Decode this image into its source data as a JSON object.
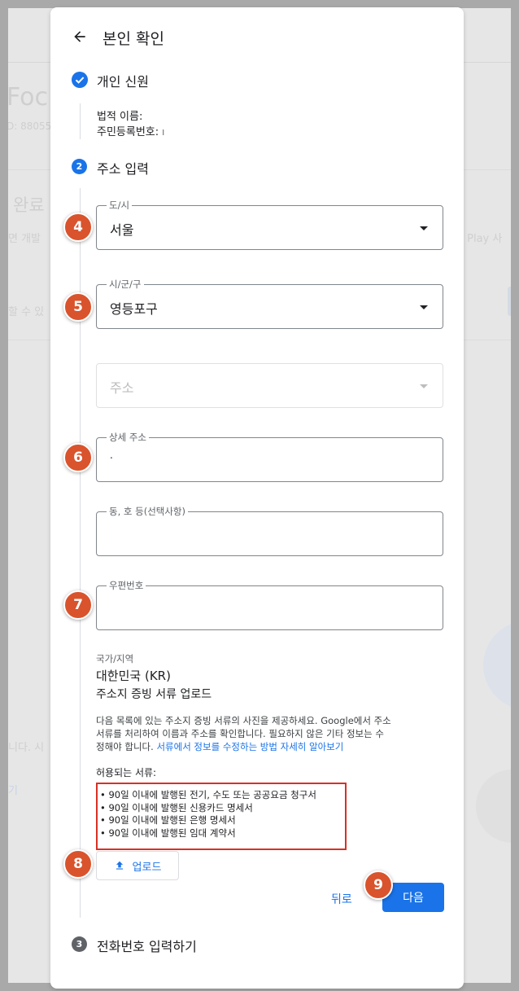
{
  "background": {
    "title_fragment": "Foc",
    "id_fragment": "D: 88055",
    "heading_fragment": "완료",
    "line1_fragment": "면 개발",
    "line1_right_fragment": "e Play 사",
    "line2_fragment": "할 수 있",
    "line3_fragment": "니다. 시",
    "line4_fragment": "기"
  },
  "dialog": {
    "title": "본인 확인",
    "step1": {
      "label": "개인 신원",
      "legal_name_label": "법적 이름:",
      "resident_number_label": "주민등록번호: ",
      "resident_number_value": "I"
    },
    "step2": {
      "number": "2",
      "label": "주소 입력",
      "fields": {
        "province": {
          "label": "도/시",
          "value": "서울"
        },
        "district": {
          "label": "시/군/구",
          "value": "영등포구"
        },
        "address": {
          "placeholder": "주소"
        },
        "detail_address": {
          "label": "상세 주소",
          "value": "."
        },
        "unit": {
          "label": "동, 호 등(선택사항)",
          "value": ""
        },
        "postal_code": {
          "label": "우편번호",
          "value": ""
        }
      },
      "country_label": "국가/지역",
      "country_value": "대한민국 (KR)",
      "upload_heading": "주소지 증빙 서류 업로드",
      "description_line1": "다음 목록에 있는 주소지 증빙 서류의 사진을 제공하세요. Google에서 주소",
      "description_line2": "서류를 처리하여 이름과 주소를 확인합니다. 필요하지 않은 기타 정보는 수",
      "description_line3": "정해야 합니다. ",
      "learn_more_link": "서류에서 정보를 수정하는 방법 자세히 알아보기",
      "accepted_docs_heading": "허용되는 서류:",
      "accepted_docs": [
        "• 90일 이내에 발행된 전기, 수도 또는 공공요금 청구서",
        "• 90일 이내에 발행된 신용카드 명세서",
        "• 90일 이내에 발행된 은행 명세서",
        "• 90일 이내에 발행된 임대 계약서"
      ],
      "upload_button": "업로드",
      "back_button": "뒤로",
      "next_button": "다음"
    },
    "step3": {
      "number": "3",
      "label": "전화번호 입력하기"
    }
  },
  "annotations": [
    "4",
    "5",
    "6",
    "7",
    "8",
    "9"
  ],
  "colors": {
    "accent": "#1a73e8",
    "badge": "#d9532c",
    "highlight_border": "#d93025",
    "step3_circle": "#5f6368"
  }
}
